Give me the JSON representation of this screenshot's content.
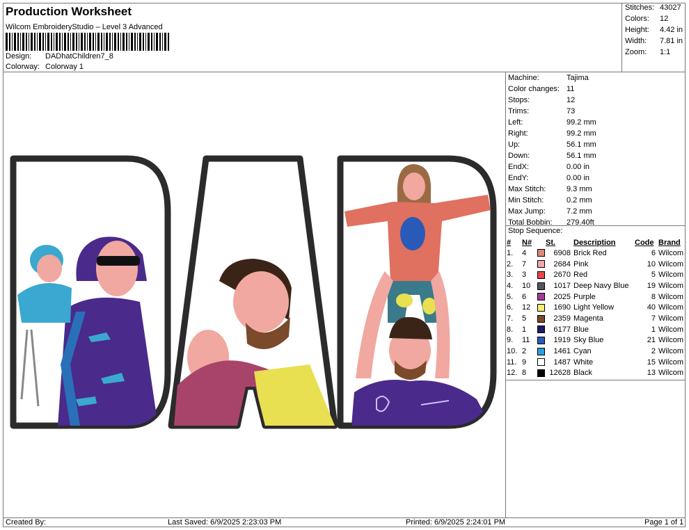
{
  "header": {
    "title": "Production Worksheet",
    "software": "Wilcom EmbroideryStudio – Level 3 Advanced",
    "design_label": "Design:",
    "design_value": "DADhatChildren7_8",
    "colorway_label": "Colorway:",
    "colorway_value": "Colorway 1"
  },
  "stats": [
    {
      "k": "Stitches:",
      "v": "43027"
    },
    {
      "k": "Colors:",
      "v": "12"
    },
    {
      "k": "Height:",
      "v": "4.42 in"
    },
    {
      "k": "Width:",
      "v": "7.81 in"
    },
    {
      "k": "Zoom:",
      "v": "1:1"
    }
  ],
  "machine_info": [
    {
      "k": "Machine:",
      "v": "Tajima"
    },
    {
      "k": "Color changes:",
      "v": "11"
    },
    {
      "k": "Stops:",
      "v": "12"
    },
    {
      "k": "Trims:",
      "v": "73"
    },
    {
      "k": "Left:",
      "v": "99.2 mm"
    },
    {
      "k": "Right:",
      "v": "99.2 mm"
    },
    {
      "k": "Up:",
      "v": "56.1 mm"
    },
    {
      "k": "Down:",
      "v": "56.1 mm"
    },
    {
      "k": "EndX:",
      "v": "0.00 in"
    },
    {
      "k": "EndY:",
      "v": "0.00 in"
    },
    {
      "k": "Max Stitch:",
      "v": "9.3 mm"
    },
    {
      "k": "Min Stitch:",
      "v": "0.2 mm"
    },
    {
      "k": "Max Jump:",
      "v": "7.2 mm"
    },
    {
      "k": "Total Bobbin:",
      "v": "279.40ft"
    }
  ],
  "stop_sequence": {
    "title": "Stop Sequence:",
    "headers": [
      "#",
      "N#",
      "St.",
      "Description",
      "Code",
      "Brand"
    ],
    "rows": [
      {
        "num": "1.",
        "n": "4",
        "color": "#e08878",
        "st": "6908",
        "desc": "Brick Red",
        "code": "6",
        "brand": "Wilcom"
      },
      {
        "num": "2.",
        "n": "7",
        "color": "#f0a8a8",
        "st": "2684",
        "desc": "Pink",
        "code": "10",
        "brand": "Wilcom"
      },
      {
        "num": "3.",
        "n": "3",
        "color": "#e84848",
        "st": "2670",
        "desc": "Red",
        "code": "5",
        "brand": "Wilcom"
      },
      {
        "num": "4.",
        "n": "10",
        "color": "#555560",
        "st": "1017",
        "desc": "Deep Navy Blue",
        "code": "19",
        "brand": "Wilcom"
      },
      {
        "num": "5.",
        "n": "6",
        "color": "#a03c98",
        "st": "2025",
        "desc": "Purple",
        "code": "8",
        "brand": "Wilcom"
      },
      {
        "num": "6.",
        "n": "12",
        "color": "#f6f070",
        "st": "1690",
        "desc": "Light Yellow",
        "code": "40",
        "brand": "Wilcom"
      },
      {
        "num": "7.",
        "n": "5",
        "color": "#7a4a2a",
        "st": "2359",
        "desc": "Magenta",
        "code": "7",
        "brand": "Wilcom"
      },
      {
        "num": "8.",
        "n": "1",
        "color": "#20186a",
        "st": "6177",
        "desc": "Blue",
        "code": "1",
        "brand": "Wilcom"
      },
      {
        "num": "9.",
        "n": "11",
        "color": "#2a5ab8",
        "st": "1919",
        "desc": "Sky Blue",
        "code": "21",
        "brand": "Wilcom"
      },
      {
        "num": "10.",
        "n": "2",
        "color": "#2aa0d8",
        "st": "1461",
        "desc": "Cyan",
        "code": "2",
        "brand": "Wilcom"
      },
      {
        "num": "11.",
        "n": "9",
        "color": "#ffffff",
        "st": "1487",
        "desc": "White",
        "code": "15",
        "brand": "Wilcom"
      },
      {
        "num": "12.",
        "n": "8",
        "color": "#000000",
        "st": "12628",
        "desc": "Black",
        "code": "13",
        "brand": "Wilcom"
      }
    ]
  },
  "footer": {
    "created": "Created By:",
    "saved": "Last Saved: 6/9/2025 2:23:03 PM",
    "printed": "Printed: 6/9/2025 2:24:01 PM",
    "page": "Page 1 of 1"
  },
  "design_colors": {
    "outline": "#2b2b2b",
    "skin": "#f0a8a0",
    "purple": "#4a2a8a",
    "cyan": "#3aa8d0",
    "brick": "#e07060",
    "yellow": "#e8e050",
    "brown": "#7a4a2a"
  }
}
